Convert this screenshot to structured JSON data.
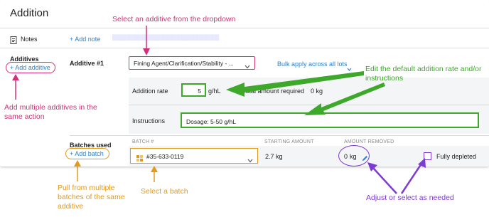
{
  "page": {
    "title": "Addition"
  },
  "notes": {
    "label": "Notes",
    "add_label": "+ Add note"
  },
  "additives": {
    "section_label": "Additives",
    "add_label": "Add additive",
    "row_label": "Additive #1",
    "dropdown_value": "Fining Agent/Clarification/Stability - ...",
    "bulk_apply": "Bulk apply across all lots",
    "rate_label": "Addition rate",
    "rate_value": "5",
    "rate_unit": "g/hL",
    "total_label": "Total amount required",
    "total_value": "0 kg",
    "instructions_label": "Instructions",
    "instructions_value": "Dosage: 5-50 g/hL"
  },
  "batches": {
    "section_label": "Batches used",
    "add_label": "Add batch",
    "columns": [
      "BATCH #",
      "STARTING AMOUNT",
      "AMOUNT REMOVED"
    ],
    "row": {
      "batch_value": "#35-633-0119",
      "starting_amount": "2.7  kg",
      "removed_value": "0",
      "removed_unit": "kg",
      "fully_depleted": "Fully depleted"
    }
  },
  "annotations": {
    "select_additive": "Select an additive from the dropdown",
    "edit_default": "Edit the default addition rate and/or instructions",
    "add_multiple": "Add multiple additives in the same action",
    "pull_batches": "Pull from multiple batches of the same additive",
    "select_batch": "Select a batch",
    "adjust": "Adjust or select as needed"
  },
  "colors": {
    "pink": "#d2317a",
    "green": "#3ea82a",
    "orange": "#e39a1b",
    "purple": "#7e3bd4",
    "link": "#2f80c6"
  }
}
